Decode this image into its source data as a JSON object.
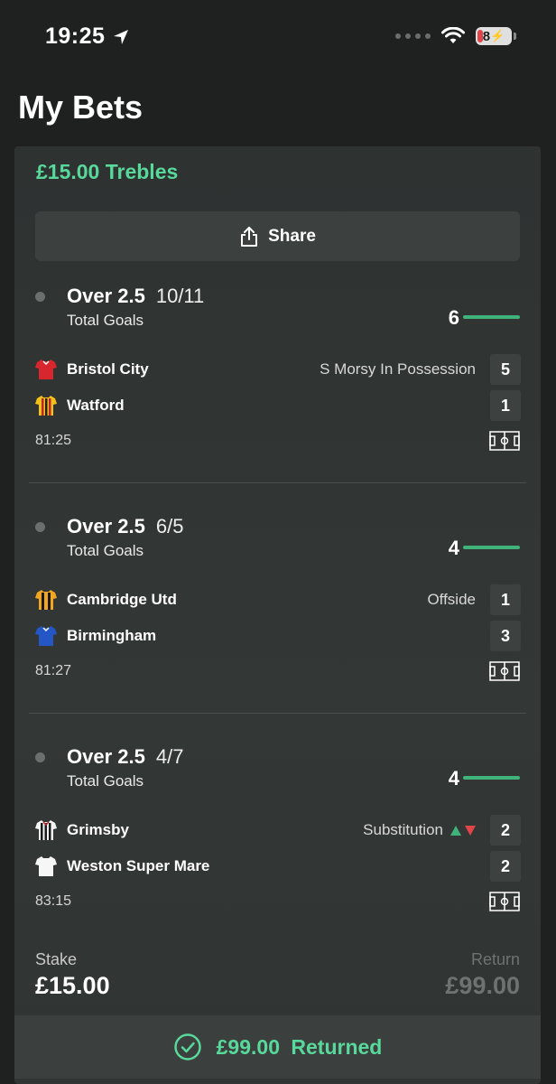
{
  "status": {
    "time": "19:25",
    "battery": "8"
  },
  "header": {
    "title": "My Bets"
  },
  "bet": {
    "type": "£15.00 Trebles",
    "share_label": "Share",
    "legs": [
      {
        "market": "Over 2.5",
        "odds": "10/11",
        "market_sub": "Total Goals",
        "goals": "6",
        "home": {
          "name": "Bristol City",
          "score": "5",
          "kit": "red"
        },
        "away": {
          "name": "Watford",
          "score": "1",
          "kit": "yellow-stripe"
        },
        "event": "S Morsy In Possession",
        "clock": "81:25"
      },
      {
        "market": "Over 2.5",
        "odds": "6/5",
        "market_sub": "Total Goals",
        "goals": "4",
        "home": {
          "name": "Cambridge Utd",
          "score": "1",
          "kit": "amber-black"
        },
        "away": {
          "name": "Birmingham",
          "score": "3",
          "kit": "blue"
        },
        "event": "Offside",
        "clock": "81:27"
      },
      {
        "market": "Over 2.5",
        "odds": "4/7",
        "market_sub": "Total Goals",
        "goals": "4",
        "home": {
          "name": "Grimsby",
          "score": "2",
          "kit": "black-white-stripe"
        },
        "away": {
          "name": "Weston Super Mare",
          "score": "2",
          "kit": "white"
        },
        "event": "Substitution",
        "clock": "83:15"
      }
    ],
    "stake_label": "Stake",
    "stake_value": "£15.00",
    "return_label": "Return",
    "return_value": "£99.00",
    "returned_amount": "£99.00",
    "returned_label": "Returned"
  },
  "colors": {
    "accent": "#58d89a",
    "goal_bar": "#3fb37a",
    "card": "#313534",
    "background": "#1f2121"
  }
}
